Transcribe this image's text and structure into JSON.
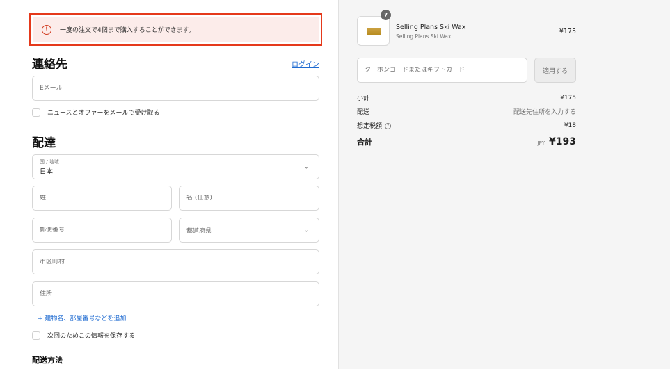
{
  "error": {
    "message": "一度の注文で4個まで購入することができます。",
    "icon": "alert-circle-icon"
  },
  "contact": {
    "title": "連絡先",
    "login_label": "ログイン",
    "email_placeholder": "Eメール",
    "newsletter_label": "ニュースとオファーをメールで受け取る"
  },
  "delivery": {
    "title": "配達",
    "country_label": "国 / 地域",
    "country_value": "日本",
    "last_name_placeholder": "姓",
    "first_name_placeholder": "名 (任意)",
    "postal_placeholder": "郵便番号",
    "prefecture_placeholder": "都道府県",
    "city_placeholder": "市区町村",
    "address_placeholder": "住所",
    "add_address_line": "+ 建物名、部屋番号などを追加",
    "save_info_label": "次回のためこの情報を保存する",
    "shipping_method_title": "配送方法"
  },
  "summary": {
    "product": {
      "name": "Selling Plans Ski Wax",
      "variant": "Selling Plans Ski Wax",
      "price": "¥175",
      "quantity": "7"
    },
    "coupon_placeholder": "クーポンコードまたはギフトカード",
    "apply_label": "適用する",
    "subtotal_label": "小計",
    "subtotal_value": "¥175",
    "shipping_label": "配送",
    "shipping_value": "配送先住所を入力する",
    "tax_label": "想定税額",
    "tax_value": "¥18",
    "total_label": "合計",
    "total_currency": "JPY",
    "total_value": "¥193"
  },
  "colors": {
    "error_border": "#e5391b",
    "error_bg": "#fcecea",
    "link": "#1f6bd1",
    "sidebar_bg": "#f5f5f5"
  }
}
